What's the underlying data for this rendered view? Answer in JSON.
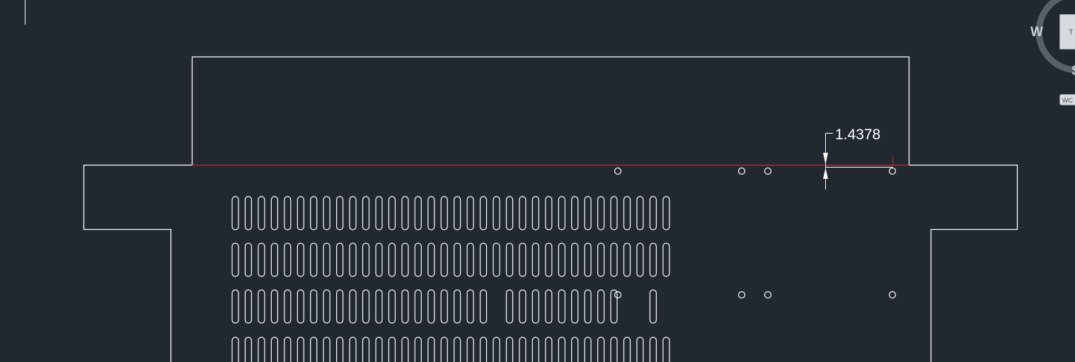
{
  "drawing": {
    "dimension_text": "1.4378",
    "line_color": "#ffffff",
    "highlight_line_color": "#c0272d",
    "background_color": "#212830"
  },
  "slots": {
    "rows": 4,
    "columns": 34,
    "row3_gap_columns": [
      20,
      30,
      31,
      33
    ]
  },
  "viewcube": {
    "west_label": "W",
    "south_label": "S",
    "top_face_label": "T",
    "wcs_label": "WC"
  }
}
